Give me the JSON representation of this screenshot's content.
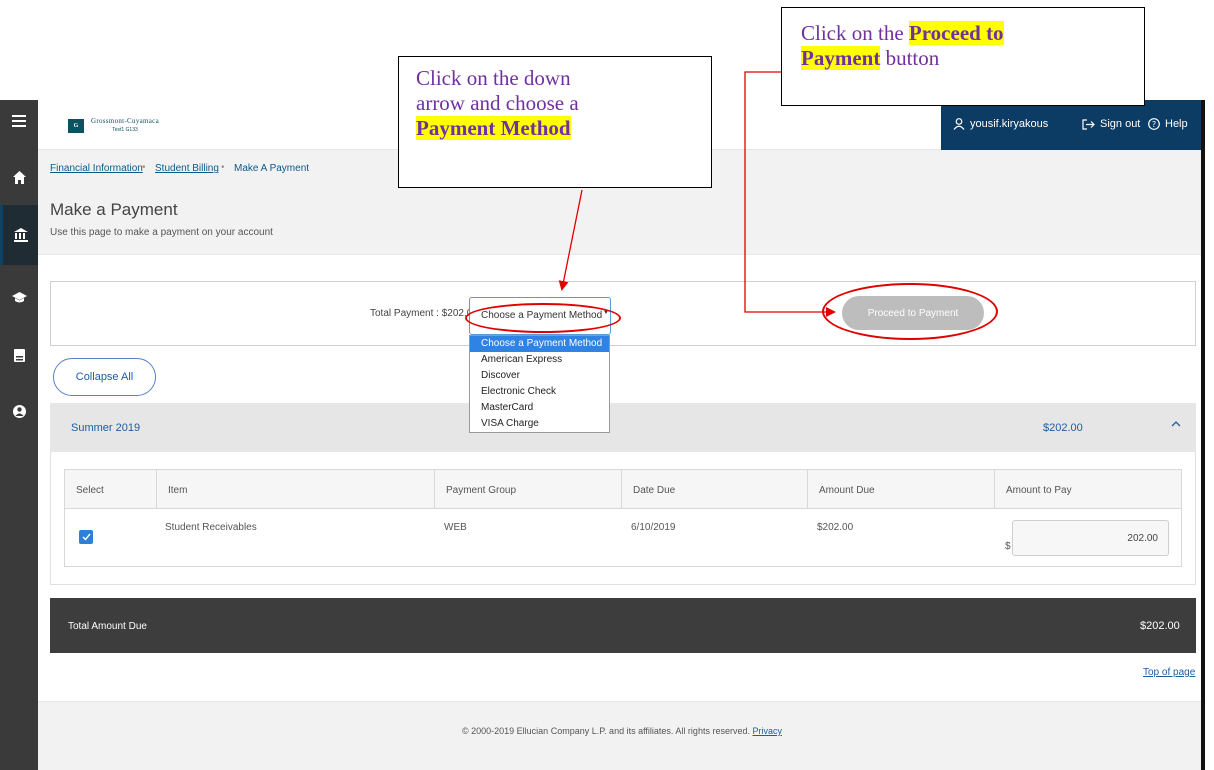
{
  "header": {
    "logo_mark": "G",
    "logo_name": "Grossmont-Cuyamaca",
    "logo_sub": "Test1 G133",
    "user_name": "yousif.kiryakous",
    "sign_out": "Sign out",
    "help": "Help"
  },
  "breadcrumb": {
    "items": [
      "Financial Information",
      "Student Billing"
    ],
    "separator": "•",
    "current": "Make A Payment"
  },
  "page": {
    "title": "Make a Payment",
    "subtitle": "Use this page to make a payment on your account"
  },
  "payment": {
    "total_label": "Total Payment : $202.00",
    "method_selected": "Choose a Payment Method",
    "method_caret": "▼",
    "method_options": [
      "Choose a Payment Method",
      "American Express",
      "Discover",
      "Electronic Check",
      "MasterCard",
      "VISA Charge"
    ],
    "proceed_label": "Proceed to Payment"
  },
  "collapse_label": "Collapse All",
  "term": {
    "name": "Summer 2019",
    "amount": "$202.00"
  },
  "table": {
    "headers": [
      "Select",
      "Item",
      "Payment Group",
      "Date Due",
      "Amount Due",
      "Amount to Pay"
    ],
    "rows": [
      {
        "item": "Student Receivables",
        "payment_group": "WEB",
        "date_due": "6/10/2019",
        "amount_due": "$202.00",
        "prefix": "$",
        "amount_to_pay": "202.00",
        "checked": true
      }
    ]
  },
  "total": {
    "label": "Total Amount Due",
    "amount": "$202.00"
  },
  "top_of_page": "Top of page",
  "footer": {
    "copyright": "© 2000-2019 Ellucian Company L.P. and its affiliates. All rights reserved.",
    "privacy": "Privacy"
  },
  "callouts": {
    "one": {
      "line1": "Click on the down",
      "line2": "arrow and choose a",
      "highlight": "Payment Method"
    },
    "two": {
      "prefix": "Click on the ",
      "highlight1": "Proceed to",
      "highlight2": "Payment",
      "suffix": " button"
    }
  },
  "colors": {
    "annotation_red": "#e00000",
    "callout_text": "#7030a0",
    "highlight": "#ffff00",
    "brand_navy": "#0c3c64",
    "link_blue": "#1f5da0"
  }
}
